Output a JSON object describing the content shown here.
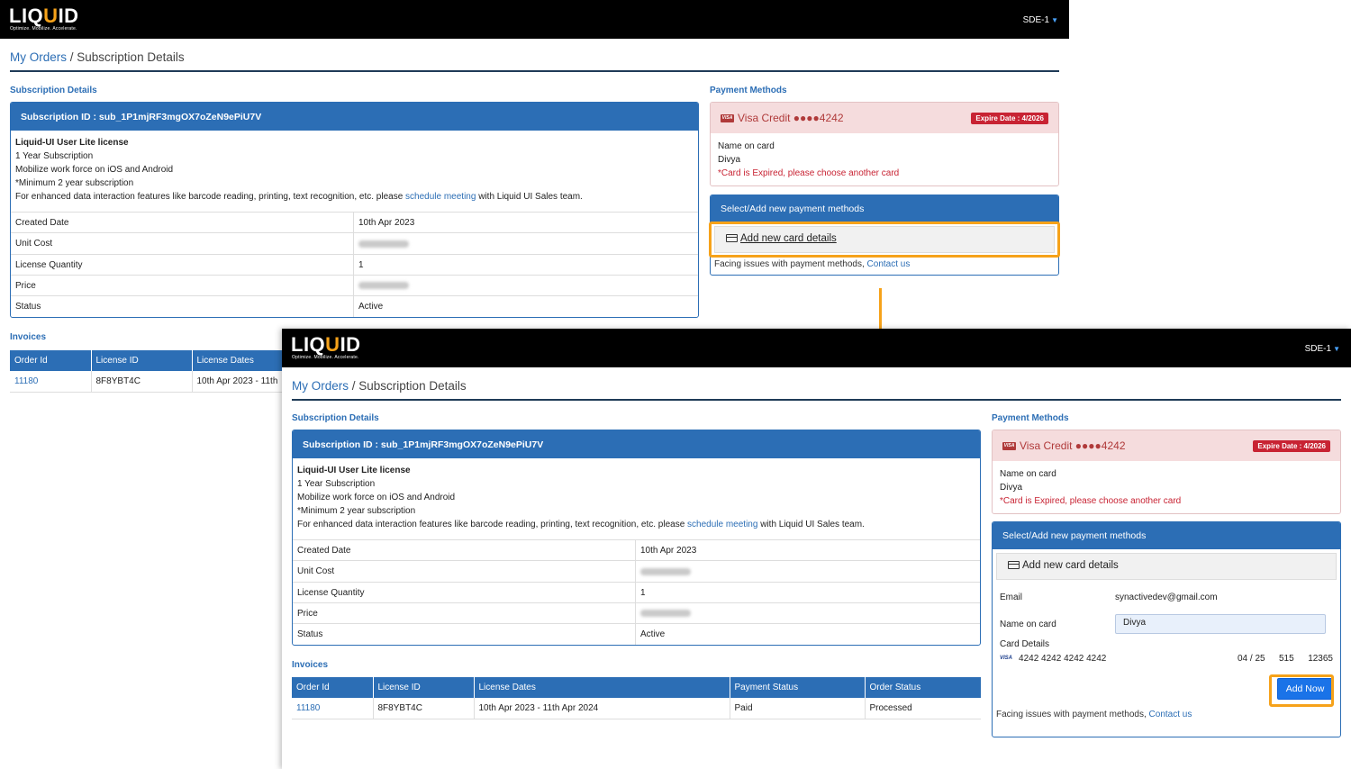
{
  "app": {
    "logo_main": "LIQ",
    "logo_accent": "U",
    "logo_end": "ID",
    "tagline": "Optimize. Mobilize. Accelerate.",
    "user": "SDE-1"
  },
  "breadcrumb": {
    "root": "My Orders",
    "separator": " / ",
    "current": "Subscription Details"
  },
  "subscription": {
    "section_title": "Subscription Details",
    "header": "Subscription ID : sub_1P1mjRF3mgOX7oZeN9ePiU7V",
    "product": "Liquid-UI User Lite license",
    "term": "1 Year Subscription",
    "feature": "Mobilize work force on iOS and Android",
    "minimum": "*Minimum 2 year subscription",
    "enhanced_pre": "For enhanced data interaction features like barcode reading, printing, text recognition, etc. please ",
    "enhanced_link": "schedule meeting",
    "enhanced_post": " with Liquid UI Sales team.",
    "rows": [
      {
        "label": "Created Date",
        "value": "10th Apr 2023"
      },
      {
        "label": "Unit Cost",
        "value": ""
      },
      {
        "label": "License Quantity",
        "value": "1"
      },
      {
        "label": "Price",
        "value": ""
      },
      {
        "label": "Status",
        "value": "Active"
      }
    ]
  },
  "invoices": {
    "section_title": "Invoices",
    "columns": [
      "Order Id",
      "License ID",
      "License Dates",
      "Payment Status",
      "Order Status"
    ],
    "back_columns": [
      "Order Id",
      "License ID",
      "License Dates"
    ],
    "row": {
      "order_id": "11180",
      "license_id": "8F8YBT4C",
      "dates": "10th Apr 2023 - 11th Apr 2024",
      "dates_truncated": "10th Apr 2023 - 11th",
      "payment": "Paid",
      "status": "Processed"
    }
  },
  "payment": {
    "section_title": "Payment Methods",
    "card_brand": "VISA",
    "card_label": "Visa Credit ●●●●4242",
    "expire": "Expire Date : 4/2026",
    "name_label": "Name on card",
    "name_value": "Divya",
    "error": "*Card is Expired, please choose another card"
  },
  "methods": {
    "header": "Select/Add new payment methods",
    "add_card": "Add new card details",
    "facing_pre": "Facing issues with payment methods, ",
    "facing_link": "Contact us"
  },
  "form": {
    "email_label": "Email",
    "email_value": "synactivedev@gmail.com",
    "name_label": "Name on card",
    "name_value": "Divya",
    "card_details_label": "Card Details",
    "card_brand": "VISA",
    "card_number": "4242 4242 4242 4242",
    "card_exp": "04 / 25",
    "card_cvc": "515",
    "card_zip": "12365",
    "add_now": "Add Now"
  },
  "colors": {
    "accent": "#f6a21a",
    "primary": "#2c6eb5",
    "danger": "#c82333"
  }
}
